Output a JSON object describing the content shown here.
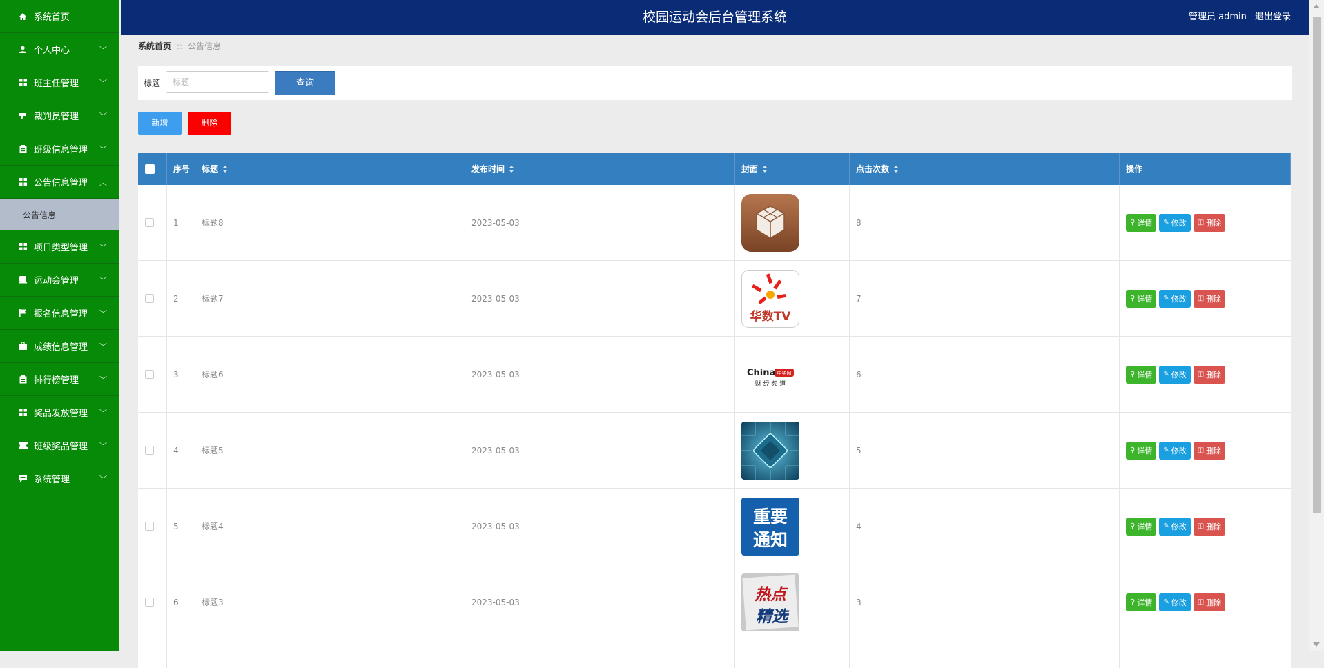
{
  "app": {
    "title": "校园运动会后台管理系统"
  },
  "header": {
    "user_label": "管理员 admin",
    "logout_label": "退出登录"
  },
  "sidebar": {
    "items": [
      {
        "label": "系统首页",
        "icon": "home-icon",
        "glyph": "⌂",
        "chevron": false
      },
      {
        "label": "个人中心",
        "icon": "user-icon",
        "glyph": "●",
        "chevron": true
      },
      {
        "label": "班主任管理",
        "icon": "grid-icon",
        "glyph": "▦",
        "chevron": true
      },
      {
        "label": "裁判员管理",
        "icon": "whistle-icon",
        "glyph": "▼",
        "chevron": true
      },
      {
        "label": "班级信息管理",
        "icon": "clipboard-icon",
        "glyph": "▣",
        "chevron": true
      },
      {
        "label": "公告信息管理",
        "icon": "grid-icon",
        "glyph": "▦",
        "chevron": true,
        "expanded": true
      },
      {
        "label": "项目类型管理",
        "icon": "grid-icon",
        "glyph": "▦",
        "chevron": true
      },
      {
        "label": "运动会管理",
        "icon": "box-icon",
        "glyph": "■",
        "chevron": true
      },
      {
        "label": "报名信息管理",
        "icon": "flag-icon",
        "glyph": "⚑",
        "chevron": true
      },
      {
        "label": "成绩信息管理",
        "icon": "briefcase-icon",
        "glyph": "▬",
        "chevron": true
      },
      {
        "label": "排行榜管理",
        "icon": "clipboard-icon",
        "glyph": "▣",
        "chevron": true
      },
      {
        "label": "奖品发放管理",
        "icon": "grid-icon",
        "glyph": "▦",
        "chevron": true
      },
      {
        "label": "班级奖品管理",
        "icon": "ticket-icon",
        "glyph": "▬",
        "chevron": true
      },
      {
        "label": "系统管理",
        "icon": "chat-icon",
        "glyph": "▪",
        "chevron": true
      }
    ],
    "sub_items": [
      {
        "label": "公告信息",
        "active": true
      }
    ]
  },
  "breadcrumb": {
    "home": "系统首页",
    "separator": "::",
    "current": "公告信息"
  },
  "search": {
    "label": "标题",
    "placeholder": "标题",
    "value": "",
    "query_button": "查询"
  },
  "toolbar": {
    "add_label": "新增",
    "delete_label": "删除"
  },
  "table": {
    "columns": [
      "序号",
      "标题",
      "发布时间",
      "封面",
      "点击次数",
      "操作"
    ],
    "rows": [
      {
        "index": "1",
        "title": "标题8",
        "date": "2023-05-03",
        "cover": "cydia-cover",
        "clicks": "8"
      },
      {
        "index": "2",
        "title": "标题7",
        "date": "2023-05-03",
        "cover": "huashu-tv-cover",
        "clicks": "7"
      },
      {
        "index": "3",
        "title": "标题6",
        "date": "2023-05-03",
        "cover": "china-finance-cover",
        "clicks": "6"
      },
      {
        "index": "4",
        "title": "标题5",
        "date": "2023-05-03",
        "cover": "circuit-chip-cover",
        "clicks": "5"
      },
      {
        "index": "5",
        "title": "标题4",
        "date": "2023-05-03",
        "cover": "notice-cover",
        "clicks": "4"
      },
      {
        "index": "6",
        "title": "标题3",
        "date": "2023-05-03",
        "cover": "hot-picks-cover",
        "clicks": "3"
      }
    ],
    "actions": {
      "detail": "详情",
      "edit": "修改",
      "delete": "删除"
    }
  },
  "covers": {
    "huashu": {
      "text": "华数TV"
    },
    "china": {
      "brand": "China",
      "tag": "中华网",
      "sub": "财 经 频 道"
    },
    "notice": {
      "line1": "重要",
      "line2": "通知"
    },
    "hot": {
      "line1": "热点",
      "line2": "精选"
    }
  },
  "colors": {
    "sidebar_bg": "#078a07",
    "header_bg": "#0a2b75",
    "table_header_bg": "#347fbf",
    "query_button": "#3b7bbf",
    "add_button": "#3d9ef0",
    "delete_button": "#fc0000",
    "detail_action": "#3db42c",
    "edit_action": "#1a9fe0",
    "delete_action": "#d9534f"
  }
}
